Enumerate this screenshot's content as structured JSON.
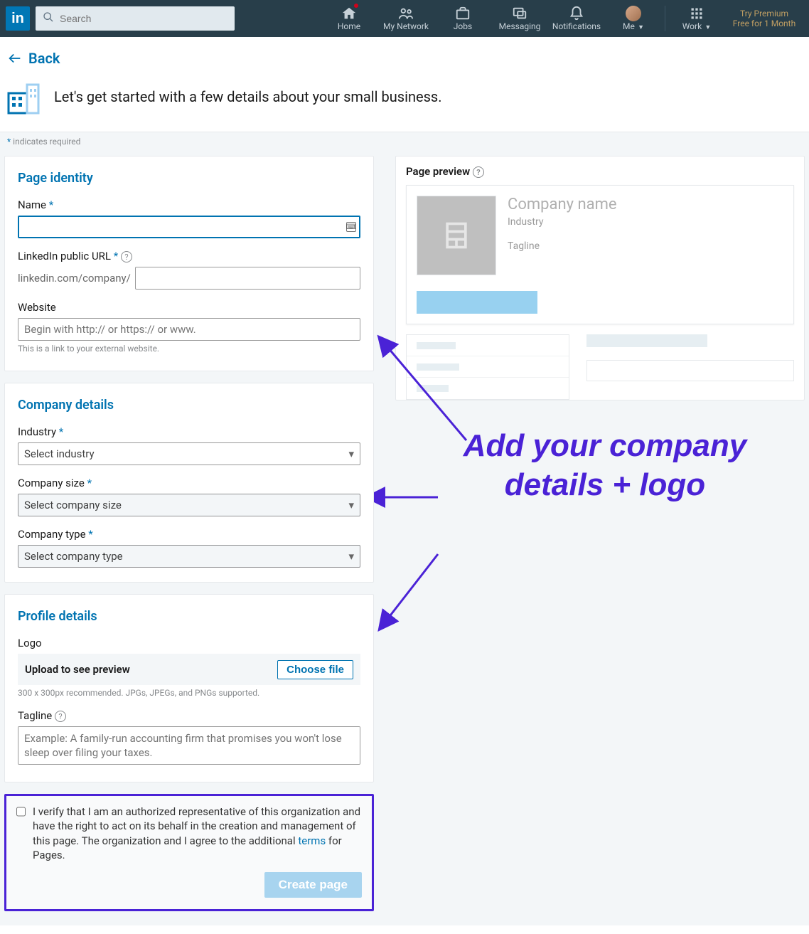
{
  "nav": {
    "search_placeholder": "Search",
    "home": "Home",
    "network": "My Network",
    "jobs": "Jobs",
    "messaging": "Messaging",
    "notifications": "Notifications",
    "me": "Me",
    "work": "Work",
    "premium_l1": "Try Premium",
    "premium_l2": "Free for 1 Month"
  },
  "back_label": "Back",
  "hero_text": "Let's get started with a few details about your small business.",
  "required_note_prefix": "*",
  "required_note": " indicates required",
  "identity": {
    "heading": "Page identity",
    "name_label": "Name",
    "url_label": "LinkedIn public URL",
    "url_prefix": "linkedin.com/company/",
    "website_label": "Website",
    "website_placeholder": "Begin with http:// or https:// or www.",
    "website_hint": "This is a link to your external website."
  },
  "company": {
    "heading": "Company details",
    "industry_label": "Industry",
    "industry_select": "Select industry",
    "size_label": "Company size",
    "size_select": "Select company size",
    "type_label": "Company type",
    "type_select": "Select company type"
  },
  "profile": {
    "heading": "Profile details",
    "logo_label": "Logo",
    "upload_label": "Upload to see preview",
    "choose_file": "Choose file",
    "logo_hint": "300 x 300px recommended. JPGs, JPEGs, and PNGs supported.",
    "tagline_label": "Tagline",
    "tagline_placeholder": "Example: A family-run accounting firm that promises you won't lose sleep over filing your taxes."
  },
  "verify": {
    "text_a": "I verify that I am an authorized representative of this organization and have the right to act on its behalf in the creation and management of this page. The organization and I agree to the additional ",
    "terms": "terms",
    "text_b": " for Pages.",
    "create": "Create page"
  },
  "preview": {
    "title": "Page preview",
    "company_name": "Company name",
    "industry": "Industry",
    "tagline": "Tagline"
  },
  "annotation": "Add your company details + logo"
}
